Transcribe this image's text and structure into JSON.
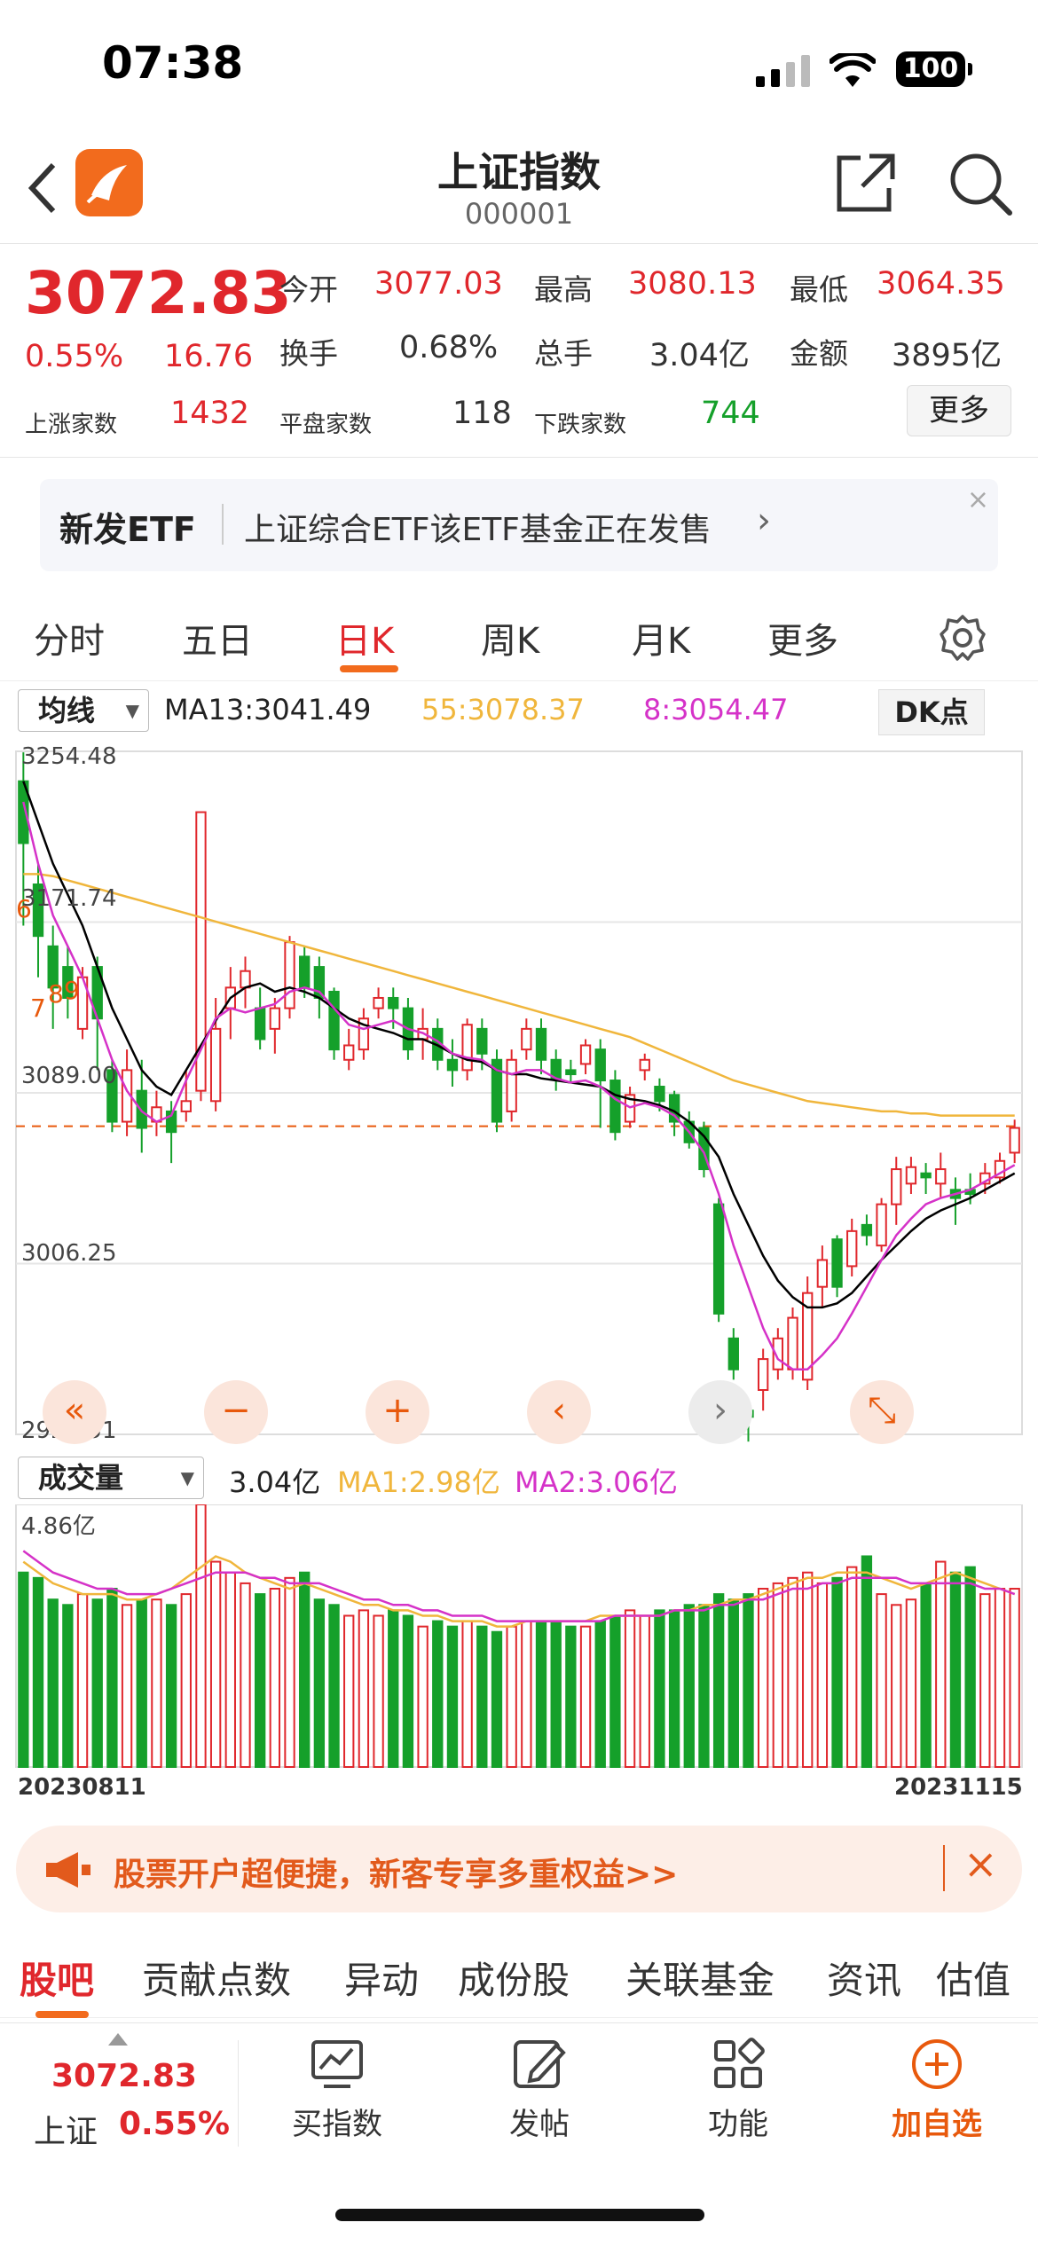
{
  "status": {
    "time": "07:38",
    "battery": "100"
  },
  "header": {
    "title": "上证指数",
    "code": "000001"
  },
  "quote": {
    "price": "3072.83",
    "pct": "0.55%",
    "change": "16.76",
    "open_label": "今开",
    "open": "3077.03",
    "high_label": "最高",
    "high": "3080.13",
    "low_label": "最低",
    "low": "3064.35",
    "turnover_label": "换手",
    "turnover": "0.68%",
    "volume_label": "总手",
    "volume": "3.04亿",
    "amount_label": "金额",
    "amount": "3895亿",
    "up_label": "上涨家数",
    "up": "1432",
    "flat_label": "平盘家数",
    "flat": "118",
    "down_label": "下跌家数",
    "down": "744",
    "more": "更多"
  },
  "banner": {
    "tag": "新发ETF",
    "text": "上证综合ETF该ETF基金正在发售",
    "arrow": "›",
    "close": "×"
  },
  "tabs": [
    "分时",
    "五日",
    "日K",
    "周K",
    "月K",
    "更多"
  ],
  "ma": {
    "selector": "均线",
    "ma13": "MA13:3041.49",
    "ma55": "55:3078.37",
    "ma8": "8:3054.47",
    "dk": "DK点"
  },
  "axis": {
    "y1": "3254.48",
    "y2": "3171.74",
    "y3": "3089.00",
    "y4": "3006.25",
    "y5": "2923.51",
    "v_top": "4.86亿",
    "date_start": "20230811",
    "date_end": "20231115"
  },
  "markers": [
    "6",
    "7",
    "8",
    "9"
  ],
  "vol": {
    "selector": "成交量",
    "total": "3.04亿",
    "ma1": "MA1:2.98亿",
    "ma2": "MA2:3.06亿"
  },
  "controls": [
    "«",
    "−",
    "+",
    "‹",
    "›",
    "⤡"
  ],
  "ad": {
    "text": "股票开户超便捷，新客专享多重权益>>",
    "close": "×"
  },
  "bottom_tabs": [
    "股吧",
    "贡献点数",
    "异动",
    "成份股",
    "关联基金",
    "资讯",
    "估值"
  ],
  "toolbar": {
    "price": "3072.83",
    "name": "上证",
    "pct": "0.55%",
    "buy": "买指数",
    "post": "发帖",
    "func": "功能",
    "add": "加自选"
  },
  "colors": {
    "up": "#e0272c",
    "down": "#15a02a",
    "accent": "#f26b1d",
    "ma13": "#000000",
    "ma55": "#f0b63c",
    "ma8": "#d532c8"
  },
  "chart_data": {
    "type": "candlestick",
    "x_start": "20230811",
    "x_end": "20231115",
    "ylim": [
      2923.51,
      3254.48
    ],
    "yticks": [
      3254.48,
      3171.74,
      3089.0,
      3006.25,
      2923.51
    ],
    "ref_line": 3072.83,
    "candles": [
      [
        3240,
        3210,
        3254,
        3170
      ],
      [
        3190,
        3165,
        3200,
        3145
      ],
      [
        3160,
        3140,
        3170,
        3120
      ],
      [
        3150,
        3135,
        3160,
        3125
      ],
      [
        3120,
        3145,
        3150,
        3115
      ],
      [
        3150,
        3125,
        3155,
        3100
      ],
      [
        3100,
        3075,
        3105,
        3070
      ],
      [
        3075,
        3100,
        3110,
        3068
      ],
      [
        3090,
        3072,
        3105,
        3060
      ],
      [
        3075,
        3082,
        3090,
        3068
      ],
      [
        3080,
        3070,
        3085,
        3055
      ],
      [
        3080,
        3085,
        3100,
        3075
      ],
      [
        3090,
        3225,
        3225,
        3085
      ],
      [
        3085,
        3120,
        3135,
        3080
      ],
      [
        3130,
        3140,
        3150,
        3115
      ],
      [
        3140,
        3148,
        3155,
        3130
      ],
      [
        3130,
        3115,
        3140,
        3110
      ],
      [
        3120,
        3130,
        3135,
        3108
      ],
      [
        3130,
        3162,
        3165,
        3125
      ],
      [
        3155,
        3140,
        3160,
        3135
      ],
      [
        3150,
        3135,
        3155,
        3125
      ],
      [
        3138,
        3110,
        3140,
        3105
      ],
      [
        3105,
        3112,
        3120,
        3100
      ],
      [
        3110,
        3125,
        3130,
        3105
      ],
      [
        3130,
        3135,
        3140,
        3125
      ],
      [
        3135,
        3130,
        3140,
        3120
      ],
      [
        3130,
        3110,
        3135,
        3105
      ],
      [
        3115,
        3120,
        3130,
        3105
      ],
      [
        3120,
        3105,
        3125,
        3100
      ],
      [
        3105,
        3100,
        3115,
        3092
      ],
      [
        3100,
        3122,
        3125,
        3095
      ],
      [
        3120,
        3108,
        3125,
        3100
      ],
      [
        3105,
        3075,
        3110,
        3070
      ],
      [
        3080,
        3105,
        3110,
        3075
      ],
      [
        3110,
        3120,
        3125,
        3105
      ],
      [
        3120,
        3105,
        3125,
        3098
      ],
      [
        3105,
        3096,
        3110,
        3090
      ],
      [
        3100,
        3098,
        3105,
        3094
      ],
      [
        3103,
        3112,
        3115,
        3098
      ],
      [
        3110,
        3095,
        3115,
        3072
      ],
      [
        3095,
        3070,
        3100,
        3066
      ],
      [
        3075,
        3088,
        3092,
        3072
      ],
      [
        3100,
        3105,
        3108,
        3095
      ],
      [
        3092,
        3085,
        3096,
        3080
      ],
      [
        3088,
        3075,
        3090,
        3068
      ],
      [
        3075,
        3065,
        3080,
        3062
      ],
      [
        3072,
        3052,
        3075,
        3048
      ],
      [
        3035,
        2982,
        3038,
        2978
      ],
      [
        2970,
        2955,
        2975,
        2950
      ],
      [
        2935,
        2932,
        2940,
        2920
      ],
      [
        2945,
        2960,
        2965,
        2935
      ],
      [
        2955,
        2970,
        2975,
        2950
      ],
      [
        2955,
        2980,
        2985,
        2950
      ],
      [
        2950,
        2992,
        3000,
        2945
      ],
      [
        2995,
        3008,
        3015,
        2985
      ],
      [
        3018,
        2995,
        3020,
        2990
      ],
      [
        3005,
        3022,
        3028,
        3000
      ],
      [
        3025,
        3020,
        3030,
        3015
      ],
      [
        3015,
        3035,
        3038,
        3012
      ],
      [
        3035,
        3052,
        3058,
        3025
      ],
      [
        3045,
        3053,
        3058,
        3040
      ],
      [
        3050,
        3048,
        3055,
        3040
      ],
      [
        3045,
        3052,
        3060,
        3038
      ],
      [
        3042,
        3038,
        3048,
        3025
      ],
      [
        3042,
        3040,
        3050,
        3035
      ],
      [
        3045,
        3050,
        3055,
        3040
      ],
      [
        3048,
        3056,
        3060,
        3045
      ],
      [
        3060,
        3072,
        3076,
        3055
      ]
    ],
    "ma13": [
      3240,
      3220,
      3200,
      3185,
      3170,
      3150,
      3130,
      3115,
      3100,
      3092,
      3088,
      3100,
      3112,
      3124,
      3135,
      3140,
      3142,
      3138,
      3140,
      3138,
      3135,
      3130,
      3125,
      3122,
      3120,
      3118,
      3115,
      3115,
      3112,
      3108,
      3105,
      3104,
      3100,
      3098,
      3098,
      3096,
      3095,
      3094,
      3093,
      3092,
      3088,
      3086,
      3085,
      3083,
      3080,
      3075,
      3068,
      3058,
      3040,
      3025,
      3010,
      2998,
      2990,
      2985,
      2985,
      2987,
      2992,
      3000,
      3008,
      3015,
      3022,
      3028,
      3032,
      3035,
      3038,
      3042,
      3046,
      3050
    ],
    "ma55": [
      3195,
      3195,
      3194,
      3192,
      3190,
      3188,
      3186,
      3184,
      3182,
      3180,
      3178,
      3176,
      3174,
      3172,
      3170,
      3168,
      3166,
      3164,
      3162,
      3160,
      3158,
      3156,
      3154,
      3152,
      3150,
      3148,
      3146,
      3144,
      3142,
      3140,
      3138,
      3136,
      3134,
      3132,
      3130,
      3128,
      3126,
      3124,
      3122,
      3120,
      3118,
      3116,
      3113,
      3110,
      3107,
      3104,
      3101,
      3098,
      3095,
      3093,
      3091,
      3089,
      3087,
      3085,
      3084,
      3083,
      3082,
      3081,
      3080,
      3080,
      3079,
      3079,
      3078,
      3078,
      3078,
      3078,
      3078,
      3078
    ],
    "ma8": [
      3230,
      3200,
      3175,
      3160,
      3145,
      3125,
      3105,
      3090,
      3080,
      3075,
      3078,
      3095,
      3110,
      3125,
      3130,
      3128,
      3130,
      3132,
      3138,
      3140,
      3138,
      3130,
      3122,
      3120,
      3122,
      3124,
      3120,
      3118,
      3114,
      3108,
      3106,
      3105,
      3100,
      3098,
      3100,
      3100,
      3096,
      3094,
      3095,
      3092,
      3086,
      3082,
      3084,
      3082,
      3078,
      3070,
      3060,
      3040,
      3015,
      2995,
      2975,
      2960,
      2955,
      2955,
      2962,
      2970,
      2982,
      2995,
      3008,
      3020,
      3028,
      3035,
      3038,
      3040,
      3042,
      3046,
      3050,
      3054
    ],
    "volume": [
      3.6,
      3.5,
      3.1,
      3.0,
      3.2,
      3.1,
      3.3,
      3.0,
      3.1,
      3.1,
      3.0,
      3.2,
      4.86,
      3.8,
      3.6,
      3.4,
      3.2,
      3.3,
      3.5,
      3.6,
      3.1,
      3.0,
      2.8,
      2.9,
      2.8,
      2.9,
      2.8,
      2.6,
      2.7,
      2.6,
      2.7,
      2.6,
      2.5,
      2.6,
      2.7,
      2.7,
      2.7,
      2.6,
      2.6,
      2.7,
      2.8,
      2.9,
      2.8,
      2.9,
      2.9,
      3.0,
      3.0,
      3.2,
      3.1,
      3.2,
      3.3,
      3.4,
      3.5,
      3.6,
      3.4,
      3.5,
      3.7,
      3.9,
      3.2,
      3.0,
      3.1,
      3.4,
      3.8,
      3.6,
      3.7,
      3.2,
      3.3,
      3.3
    ],
    "vol_ma1": [
      3.8,
      3.6,
      3.4,
      3.3,
      3.2,
      3.2,
      3.2,
      3.1,
      3.1,
      3.2,
      3.3,
      3.5,
      3.7,
      3.9,
      3.8,
      3.6,
      3.5,
      3.4,
      3.3,
      3.4,
      3.3,
      3.2,
      3.1,
      3.0,
      3.0,
      2.9,
      2.9,
      2.8,
      2.8,
      2.7,
      2.7,
      2.7,
      2.6,
      2.6,
      2.7,
      2.7,
      2.7,
      2.7,
      2.7,
      2.8,
      2.8,
      2.8,
      2.8,
      2.8,
      2.9,
      2.9,
      3.0,
      3.0,
      3.1,
      3.1,
      3.2,
      3.3,
      3.4,
      3.5,
      3.5,
      3.6,
      3.6,
      3.6,
      3.5,
      3.4,
      3.3,
      3.4,
      3.5,
      3.6,
      3.5,
      3.4,
      3.3,
      3.2
    ],
    "vol_ma2": [
      4.0,
      3.8,
      3.6,
      3.5,
      3.4,
      3.3,
      3.3,
      3.2,
      3.2,
      3.2,
      3.3,
      3.4,
      3.5,
      3.6,
      3.6,
      3.6,
      3.5,
      3.5,
      3.4,
      3.4,
      3.4,
      3.3,
      3.2,
      3.1,
      3.1,
      3.0,
      3.0,
      2.9,
      2.9,
      2.8,
      2.8,
      2.8,
      2.7,
      2.7,
      2.7,
      2.7,
      2.7,
      2.7,
      2.7,
      2.7,
      2.8,
      2.8,
      2.8,
      2.8,
      2.9,
      2.9,
      2.9,
      3.0,
      3.0,
      3.1,
      3.1,
      3.2,
      3.3,
      3.3,
      3.4,
      3.4,
      3.5,
      3.5,
      3.5,
      3.5,
      3.4,
      3.4,
      3.4,
      3.4,
      3.4,
      3.3,
      3.3,
      3.2
    ]
  }
}
